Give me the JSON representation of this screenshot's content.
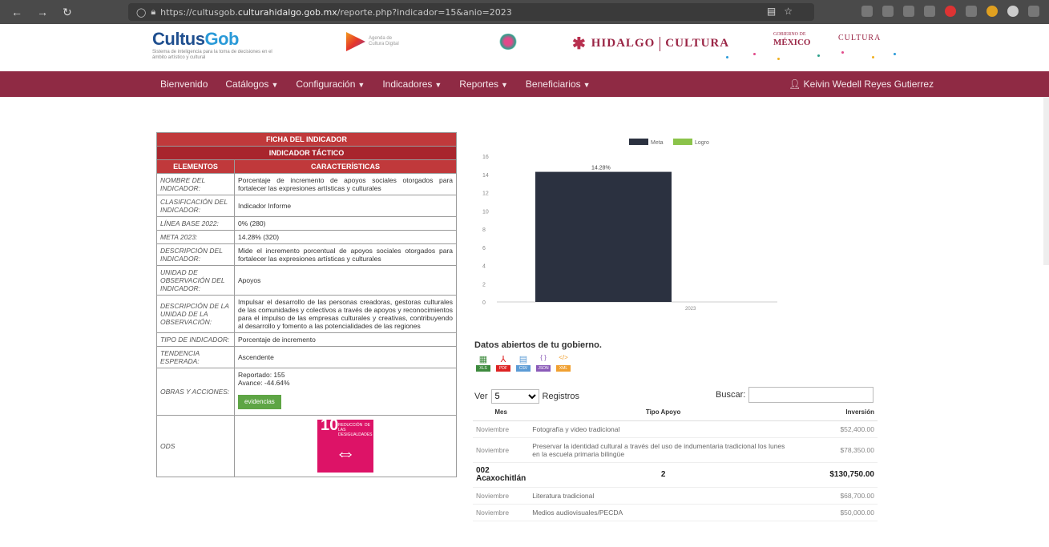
{
  "browser": {
    "url_prefix": "https://cultusgob.",
    "url_domain": "culturahidalgo.gob.mx",
    "url_path": "/reporte.php?indicador=15&anio=2023"
  },
  "header": {
    "brand_main": "Cultus",
    "brand_gob": "Gob",
    "brand_sub": "Sistema de inteligencia para la toma de decisiones en el ámbito artístico y cultural",
    "agenda_text": "Agenda de Cultura Digital",
    "hidalgo": "HIDALGO",
    "cultura": "CULTURA",
    "mexico_top": "GOBIERNO DE",
    "mexico": "MÉXICO",
    "cultura_right": "CULTURA"
  },
  "nav": {
    "items": [
      {
        "label": "Bienvenido",
        "caret": false
      },
      {
        "label": "Catálogos",
        "caret": true
      },
      {
        "label": "Configuración",
        "caret": true
      },
      {
        "label": "Indicadores",
        "caret": true
      },
      {
        "label": "Reportes",
        "caret": true
      },
      {
        "label": "Beneficiarios",
        "caret": true
      }
    ],
    "user": "Keivin Wedell Reyes Gutierrez"
  },
  "ficha": {
    "title": "FICHA DEL INDICADOR",
    "subtitle": "INDICADOR TÁCTICO",
    "col_elementos": "ELEMENTOS",
    "col_caracteristicas": "CARACTERÍSTICAS",
    "rows": [
      {
        "label": "NOMBRE DEL INDICADOR:",
        "value": "Porcentaje de incremento de apoyos sociales otorgados para fortalecer las expresiones artísticas y culturales"
      },
      {
        "label": "CLASIFICACIÓN DEL INDICADOR:",
        "value": "Indicador Informe"
      },
      {
        "label": "LÍNEA BASE 2022:",
        "value": "0% (280)"
      },
      {
        "label": "META 2023:",
        "value": "14.28% (320)"
      },
      {
        "label": "DESCRIPCIÓN DEL INDICADOR:",
        "value": "Mide el incremento porcentual de apoyos sociales otorgados para fortalecer las expresiones artísticas y culturales"
      },
      {
        "label": "UNIDAD DE OBSERVACIÓN DEL INDICADOR:",
        "value": "Apoyos"
      },
      {
        "label": "DESCRIPCIÓN DE LA UNIDAD DE LA OBSERVACIÓN:",
        "value": "Impulsar el desarrollo de las personas creadoras, gestoras culturales de las comunidades y colectivos a través de apoyos y reconocimientos para el impulso de las empresas culturales y creativas, contribuyendo al desarrollo y fomento a las potencialidades de las regiones"
      },
      {
        "label": "TIPO DE INDICADOR:",
        "value": "Porcentaje de incremento"
      },
      {
        "label": "TENDENCIA ESPERADA:",
        "value": "Ascendente"
      }
    ],
    "obras_label": "OBRAS Y ACCIONES:",
    "reportado": "Reportado: 155",
    "avance": "Avance: -44.64%",
    "evidencias": "evidencias",
    "ods_label": "ODS",
    "ods_number": "10",
    "ods_text": "REDUCCIÓN DE LAS DESIGUALDADES"
  },
  "chart_data": {
    "type": "bar",
    "categories": [
      "2023"
    ],
    "series": [
      {
        "name": "Meta",
        "values": [
          14.28
        ],
        "color": "#2b3140"
      },
      {
        "name": "Logro",
        "values": [
          0
        ],
        "color": "#8bc34a"
      }
    ],
    "data_labels": [
      "14.28%"
    ],
    "y_ticks": [
      "0",
      "2",
      "4",
      "6",
      "8",
      "10",
      "12",
      "14",
      "16"
    ],
    "ylim": [
      0,
      16
    ],
    "legend_position": "top"
  },
  "open_data": {
    "title": "Datos abiertos de tu gobierno.",
    "formats": [
      {
        "tag": "XLS",
        "color": "#3d8a3d",
        "icon": "▦"
      },
      {
        "tag": "PDF",
        "color": "#d22",
        "icon": "⅄"
      },
      {
        "tag": "CSV",
        "color": "#5b9bd5",
        "icon": "▤"
      },
      {
        "tag": "JSON",
        "color": "#8a5ab8",
        "icon": "{ }"
      },
      {
        "tag": "XML",
        "color": "#f0a030",
        "icon": "</>"
      }
    ]
  },
  "records": {
    "ver_label": "Ver",
    "ver_value": "5",
    "registros_label": "Registros",
    "buscar_label": "Buscar:",
    "headers": {
      "mes": "Mes",
      "tipo": "Tipo Apoyo",
      "inversion": "Inversión"
    },
    "rows": [
      {
        "kind": "item",
        "mes": "Noviembre",
        "tipo": "Fotografía y video tradicional",
        "inversion": "$52,400.00"
      },
      {
        "kind": "item",
        "mes": "Noviembre",
        "tipo": "Preservar la identidad cultural a través del uso de indumentaria tradicional los lunes en la escuela primaria bilingüe",
        "inversion": "$78,350.00"
      },
      {
        "kind": "group",
        "mes": "002 Acaxochitlán",
        "tipo": "2",
        "inversion": "$130,750.00"
      },
      {
        "kind": "item",
        "mes": "Noviembre",
        "tipo": "Literatura tradicional",
        "inversion": "$68,700.00"
      },
      {
        "kind": "item",
        "mes": "Noviembre",
        "tipo": "Medios audiovisuales/PECDA",
        "inversion": "$50,000.00"
      }
    ]
  }
}
